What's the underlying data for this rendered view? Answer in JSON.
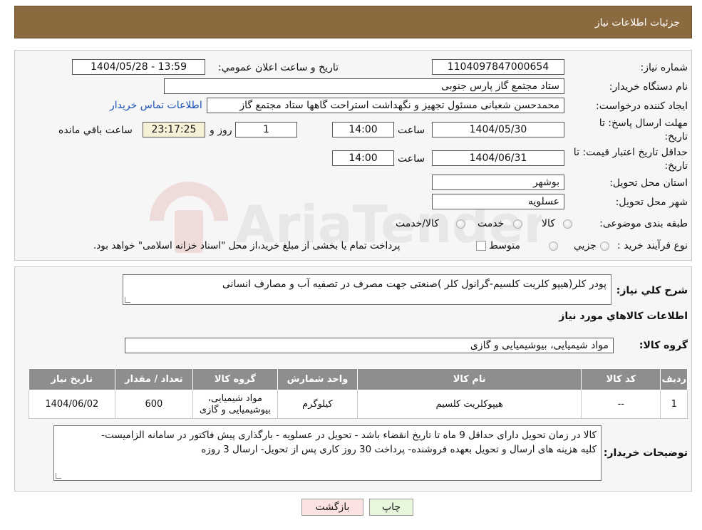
{
  "header": {
    "title": "جزئیات اطلاعات نیاز"
  },
  "watermark": {
    "text": "AriaTender.neT"
  },
  "form": {
    "need_number_label": "شماره نیاز:",
    "need_number": "1104097847000654",
    "announce_label": "تاریخ و ساعت اعلان عمومي:",
    "announce_value": "1404/05/28 - 13:59",
    "buyer_org_label": "نام دستگاه خریدار:",
    "buyer_org": "ستاد مجتمع گاز پارس جنوبی",
    "creator_label": "ایجاد کننده درخواست:",
    "creator": "محمدحسن شعبانی مسئول تجهیز و نگهداشت استراحت گاهها ستاد مجتمع گاز",
    "contact_link": "اطلاعات تماس خریدار",
    "deadline_label_1": "مهلت ارسال پاسخ: تا",
    "deadline_label_2": "تاریخ:",
    "deadline_date": "1404/05/30",
    "time_label": "ساعت",
    "deadline_time": "14:00",
    "days_value": "1",
    "days_label": "روز و",
    "remaining_time": "23:17:25",
    "remaining_label": "ساعت باقي مانده",
    "validity_label_1": "حداقل تاریخ اعتبار قیمت: تا",
    "validity_label_2": "تاریخ:",
    "validity_date": "1404/06/31",
    "validity_time": "14:00",
    "province_label": "استان محل تحویل:",
    "province": "بوشهر",
    "city_label": "شهر محل تحویل:",
    "city": "عسلویه",
    "category_label": "طبقه بندی موضوعی:",
    "category_options": [
      "کالا",
      "خدمت",
      "کالا/خدمت"
    ],
    "process_label": "نوع فرآیند خرید :",
    "process_options": [
      "جزیي",
      "متوسط"
    ],
    "process_note": "پرداخت تمام یا بخشی از مبلغ خرید،از محل \"اسناد خزانه اسلامی\" خواهد بود."
  },
  "details": {
    "summary_label": "شرح کلي نیاز:",
    "summary": "پودر کلر(هیپو کلریت کلسیم-گرانول کلر )صنعتی جهت مصرف در تصفیه آب و مصارف انسانی",
    "goods_info_title": "اطلاعات کالاهاي مورد نیاز",
    "goods_group_label": "گروه کالا:",
    "goods_group": "مواد شیمیایی، بیوشیمیایی و  گازی"
  },
  "table": {
    "headers": [
      "ردیف",
      "کد کالا",
      "نام کالا",
      "واحد شمارش",
      "گروه کالا",
      "تعداد / مقدار",
      "تاریخ نیاز"
    ],
    "rows": [
      [
        "1",
        "--",
        "هیپوکلریت کلسیم",
        "کیلوگرم",
        "مواد شیمیایی، بیوشیمیایی و گازی",
        "600",
        "1404/06/02"
      ]
    ]
  },
  "notes": {
    "label": "توضیحات خریدار:",
    "line1": "کالا در زمان تحویل دارای حداقل 9 ماه تا تاریخ انقضاء باشد - تحویل در عسلویه - بارگذاری پیش فاکتور در سامانه الزامیست-",
    "line2": "کلیه هزینه های ارسال و تحویل بعهده فروشنده- پرداخت 30 روز کاری پس از تحویل-  ارسال 3 روزه"
  },
  "buttons": {
    "print": "چاپ",
    "back": "بازگشت"
  },
  "colors": {
    "header": "#8b6a3f",
    "table_header": "#8e8e8e",
    "link": "#1a4fb3",
    "back_button": "#fde2e2",
    "print_button": "#e6f7dc"
  }
}
